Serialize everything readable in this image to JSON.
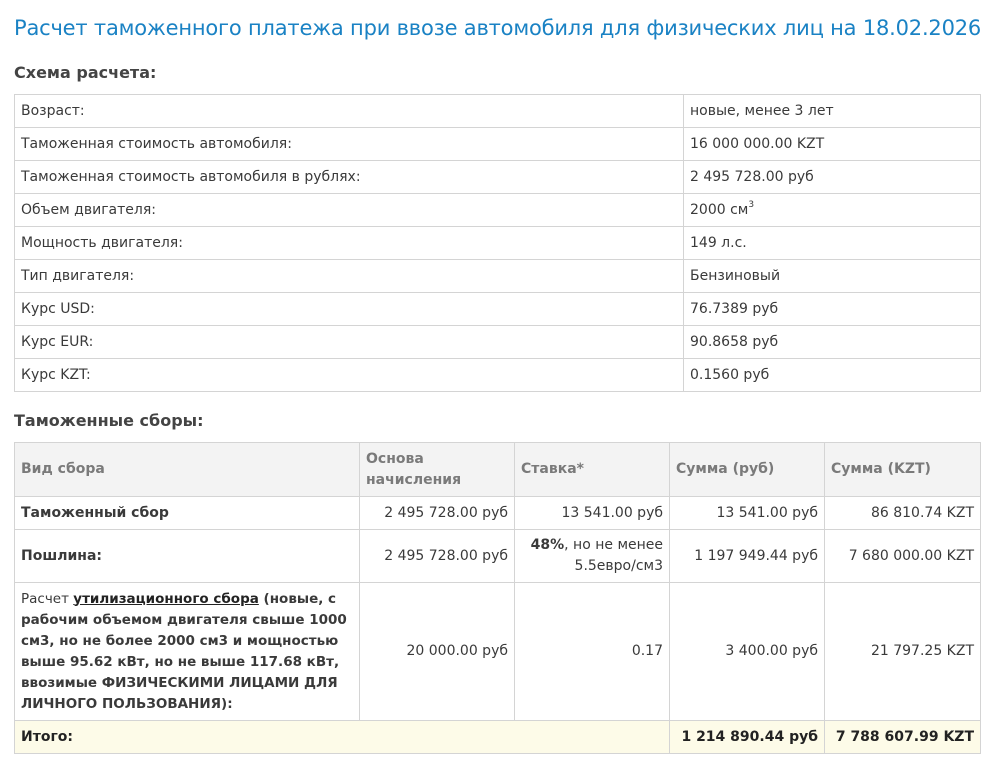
{
  "page": {
    "title": "Расчет таможенного платежа при ввозе автомобиля для физических лиц на 18.02.2026"
  },
  "scheme": {
    "heading": "Схема расчета:",
    "rows": [
      {
        "label": "Возраст:",
        "value": "новые, менее 3 лет"
      },
      {
        "label": "Таможенная стоимость автомобиля:",
        "value": "16 000 000.00 KZT"
      },
      {
        "label": "Таможенная стоимость автомобиля в рублях:",
        "value": "2 495 728.00 руб"
      },
      {
        "label": "Объем двигателя:",
        "value": "2000 см",
        "sup": "3"
      },
      {
        "label": "Мощность двигателя:",
        "value": "149 л.с."
      },
      {
        "label": "Тип двигателя:",
        "value": "Бензиновый"
      },
      {
        "label": "Курс USD:",
        "value": "76.7389 руб"
      },
      {
        "label": "Курс EUR:",
        "value": "90.8658 руб"
      },
      {
        "label": "Курс KZT:",
        "value": "0.1560 руб"
      }
    ]
  },
  "fees": {
    "heading": "Таможенные сборы:",
    "columns": [
      "Вид сбора",
      "Основа начисления",
      "Ставка*",
      "Сумма (руб)",
      "Сумма (KZT)"
    ],
    "rows": [
      {
        "name": "Таможенный сбор",
        "base": "2 495 728.00 руб",
        "rate": "13 541.00 руб",
        "sum_rub": "13 541.00 руб",
        "sum_kzt": "86 810.74 KZT"
      },
      {
        "name": "Пошлина:",
        "base": "2 495 728.00 руб",
        "rate_bold": "48%",
        "rate_rest": ", но не менее 5.5евро/см3",
        "sum_rub": "1 197 949.44 руб",
        "sum_kzt": "7 680 000.00 KZT"
      },
      {
        "name_prefix": "Расчет ",
        "name_link": "утилизационного сбора",
        "name_suffix": " (новые, с рабочим объемом двигателя свыше 1000 см3, но не более 2000 см3 и мощностью выше 95.62 кВт, но не выше 117.68 кВт, ввозимые ФИЗИЧЕСКИМИ ЛИЦАМИ ДЛЯ ЛИЧНОГО ПОЛЬЗОВАНИЯ):",
        "base": "20 000.00 руб",
        "rate": "0.17",
        "sum_rub": "3 400.00 руб",
        "sum_kzt": "21 797.25 KZT"
      }
    ],
    "total": {
      "label": "Итого:",
      "sum_rub": "1 214 890.44 руб",
      "sum_kzt": "7 788 607.99 KZT"
    }
  }
}
